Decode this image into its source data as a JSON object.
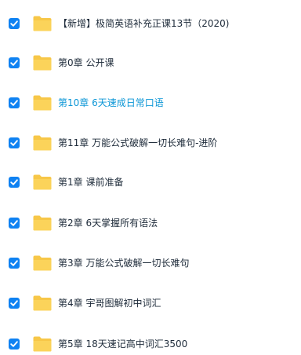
{
  "colors": {
    "checkbox": "#0f82f2",
    "folder": "#f7c748",
    "text": "#1e2b3a",
    "active_text": "#0b96d6"
  },
  "icons": {
    "checkbox": "checkbox-checked-icon",
    "folder": "folder-icon"
  },
  "items": [
    {
      "name": "【新增】极简英语补充正课13节（2020)",
      "checked": true,
      "active": false
    },
    {
      "name": "第0章 公开课",
      "checked": true,
      "active": false
    },
    {
      "name": "第10章 6天速成日常口语",
      "checked": true,
      "active": true
    },
    {
      "name": "第11章 万能公式破解一切长难句-进阶",
      "checked": true,
      "active": false
    },
    {
      "name": "第1章 课前准备",
      "checked": true,
      "active": false
    },
    {
      "name": "第2章 6天掌握所有语法",
      "checked": true,
      "active": false
    },
    {
      "name": "第3章 万能公式破解一切长难句",
      "checked": true,
      "active": false
    },
    {
      "name": "第4章 宇哥图解初中词汇",
      "checked": true,
      "active": false
    },
    {
      "name": "第5章 18天速记高中词汇3500",
      "checked": true,
      "active": false
    }
  ]
}
